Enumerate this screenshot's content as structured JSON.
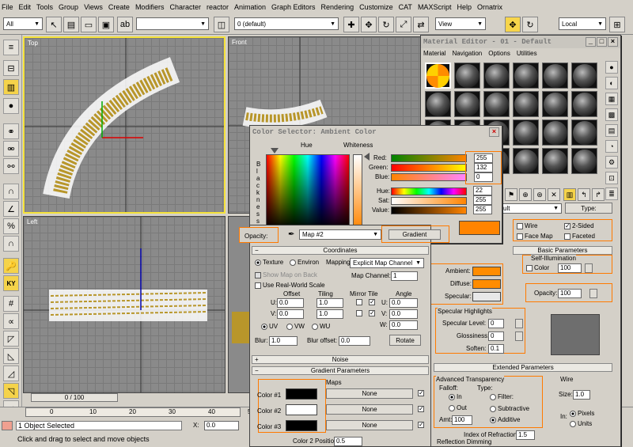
{
  "menu": [
    "File",
    "Edit",
    "Tools",
    "Group",
    "Views",
    "Create",
    "Modifiers",
    "Character",
    "reactor",
    "Animation",
    "Graph Editors",
    "Rendering",
    "Customize",
    "CAT",
    "MAXScript",
    "Help",
    "Ornatrix"
  ],
  "toolbar": {
    "selection_filter": "All",
    "layer": "0 (default)",
    "ref_coord": "View",
    "pivot": "Local"
  },
  "viewports": {
    "top": "Top",
    "front": "Front",
    "left": "Left"
  },
  "timeline": {
    "frame": "0 / 100",
    "ticks": [
      "0",
      "10",
      "20",
      "30",
      "40",
      "50"
    ]
  },
  "status": {
    "selected": "1 Object Selected",
    "prompt": "Click and drag to select and move objects",
    "x_label": "X:",
    "x_value": "0.0"
  },
  "material_editor": {
    "title": "Material Editor - 01 - Default",
    "menu": [
      "Material",
      "Navigation",
      "Options",
      "Utilities"
    ],
    "material_name": "ult",
    "type": "Type:",
    "wire": "Wire",
    "two_sided": "2-Sided",
    "face_map": "Face Map",
    "faceted": "Faceted",
    "basic_params": "Basic Parameters",
    "self_illum": "Self-Illumination",
    "color": "Color",
    "self_illum_value": "100",
    "ambient": "Ambient:",
    "diffuse": "Diffuse:",
    "specular": "Specular:",
    "opacity": "Opacity:",
    "opacity_value": "100",
    "spec_highlights": "Specular Highlights",
    "spec_level": "Specular Level:",
    "spec_level_value": "0",
    "glossiness": "Glossiness:",
    "glossiness_value": "0",
    "soften": "Soften:",
    "soften_value": "0.1",
    "extended_params": "Extended Parameters",
    "adv_transparency": "Advanced Transparency",
    "falloff": "Falloff:",
    "in": "In",
    "out": "Out",
    "filter": "Filter:",
    "subtractive": "Subtractive",
    "additive": "Additive",
    "amt": "Amt:",
    "amt_value": "100",
    "index_of_refraction": "Index of Refraction:",
    "ior_value": "1.5",
    "wire_group": "Wire",
    "size": "Size:",
    "size_value": "1.0",
    "in_units": "In:",
    "pixels": "Pixels",
    "units": "Units",
    "reflection_dimming": "Reflection Dimming"
  },
  "color_selector": {
    "title": "Color Selector: Ambient Color",
    "hue": "Hue",
    "whiteness": "Whiteness",
    "blackness": [
      "B",
      "l",
      "a",
      "c",
      "k",
      "n",
      "e",
      "s",
      "s"
    ],
    "red": "Red:",
    "red_value": "255",
    "green": "Green:",
    "green_value": "132",
    "blue": "Blue:",
    "blue_value": "0",
    "hue_label": "Hue:",
    "hue_value": "22",
    "sat": "Sat:",
    "sat_value": "255",
    "value": "Value:",
    "value_value": "255",
    "opacity": "Opacity:",
    "map": "Map #2",
    "gradient": "Gradient",
    "coordinates": "Coordinates",
    "texture": "Texture",
    "environ": "Environ",
    "mapping": "Mapping:",
    "mapping_value": "Explicit Map Channel",
    "show_map_on_back": "Show Map on Back",
    "map_channel": "Map Channel:",
    "map_channel_value": "1",
    "use_real_world": "Use Real-World Scale",
    "offset": "Offset",
    "tiling": "Tiling",
    "mirror_tile": "Mirror Tile",
    "angle": "Angle",
    "u": "U:",
    "v": "V:",
    "w": "W:",
    "u_offset": "0.0",
    "v_offset": "0.0",
    "u_tiling": "1.0",
    "v_tiling": "1.0",
    "u_angle": "0.0",
    "v_angle": "0.0",
    "w_angle": "0.0",
    "uv": "UV",
    "vw": "VW",
    "wu": "WU",
    "blur": "Blur:",
    "blur_value": "1.0",
    "blur_offset": "Blur offset:",
    "blur_offset_value": "0.0",
    "rotate": "Rotate",
    "noise": "Noise",
    "gradient_params": "Gradient Parameters",
    "maps": "Maps",
    "color1": "Color #1",
    "color2": "Color #2",
    "color3": "Color #3",
    "none": "None",
    "color2_position": "Color 2 Position:",
    "color2_position_value": "0.5"
  },
  "colors": {
    "orange": "#ff8c00",
    "swatch_orange": "#ff8400",
    "black": "#000000",
    "white": "#ffffff",
    "specular": "#e8e8e8",
    "preview": "#6e6e6e"
  }
}
